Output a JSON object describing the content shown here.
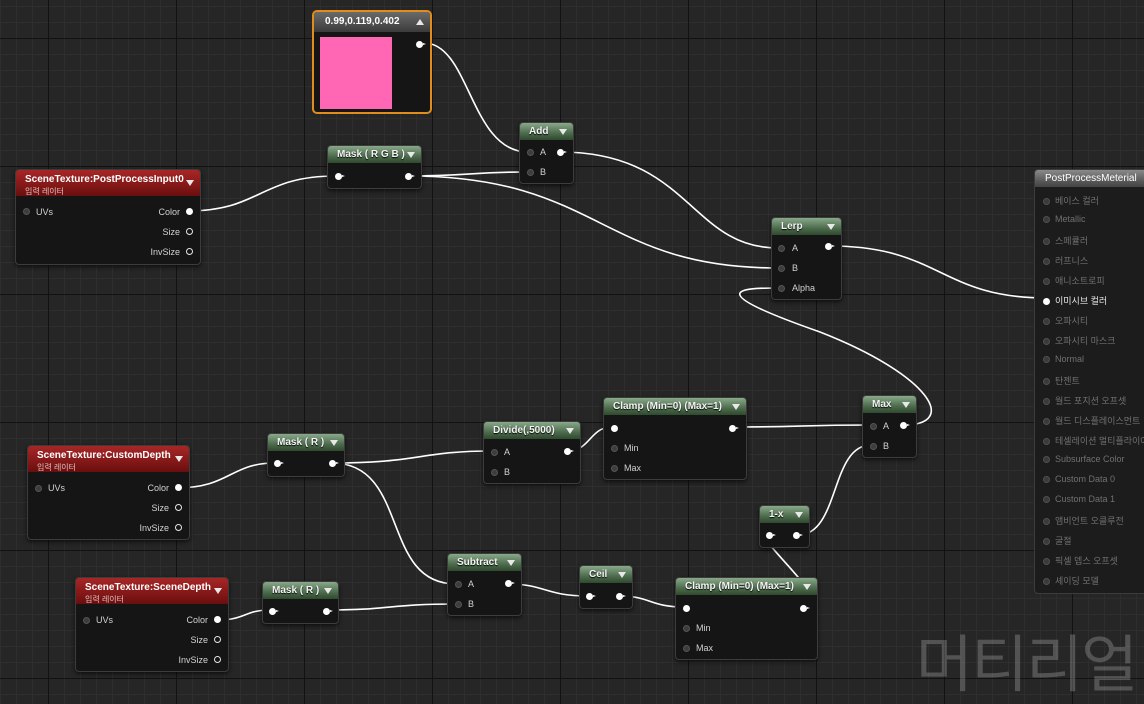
{
  "graph": {
    "constant": {
      "title": "0.99,0.119,0.402",
      "color": "#ff66b3"
    },
    "add": {
      "title": "Add",
      "a": "A",
      "b": "B"
    },
    "mask_rgb": {
      "title": "Mask ( R G B )"
    },
    "scene_pp": {
      "title": "SceneTexture:PostProcessInput0",
      "subtitle": "입력 레이터",
      "uvs": "UVs",
      "color": "Color",
      "size": "Size",
      "invsize": "InvSize"
    },
    "lerp": {
      "title": "Lerp",
      "a": "A",
      "b": "B",
      "alpha": "Alpha"
    },
    "scene_custom": {
      "title": "SceneTexture:CustomDepth",
      "subtitle": "입력 레이터",
      "uvs": "UVs",
      "color": "Color",
      "size": "Size",
      "invsize": "InvSize"
    },
    "mask_r1": {
      "title": "Mask ( R )"
    },
    "divide": {
      "title": "Divide(,5000)",
      "a": "A",
      "b": "B"
    },
    "clamp1": {
      "title": "Clamp (Min=0) (Max=1)",
      "min": "Min",
      "max": "Max"
    },
    "max": {
      "title": "Max",
      "a": "A",
      "b": "B"
    },
    "one_minus": {
      "title": "1-x"
    },
    "scene_depth": {
      "title": "SceneTexture:SceneDepth",
      "subtitle": "입력 레이터",
      "uvs": "UVs",
      "color": "Color",
      "size": "Size",
      "invsize": "InvSize"
    },
    "mask_r2": {
      "title": "Mask ( R )"
    },
    "subtract": {
      "title": "Subtract",
      "a": "A",
      "b": "B"
    },
    "ceil": {
      "title": "Ceil"
    },
    "clamp2": {
      "title": "Clamp (Min=0) (Max=1)",
      "min": "Min",
      "max": "Max"
    }
  },
  "material": {
    "title": "PostProcessMeterial",
    "inputs": [
      "베이스 컬러",
      "Metallic",
      "스페큘러",
      "러프니스",
      "애니소트로피",
      "이미시브 컬러",
      "오파시티",
      "오파시티 마스크",
      "Normal",
      "탄젠트",
      "월드 포지션 오프셋",
      "월드 디스플레이스먼트",
      "테셀레이션 멀티플라이어",
      "Subsurface Color",
      "Custom Data 0",
      "Custom Data 1",
      "앰비언트 오클루전",
      "굴절",
      "픽셀 뎁스 오프셋",
      "셰이딩 모델"
    ],
    "active_input": "이미시브 컬러"
  },
  "watermark": "머티리얼"
}
